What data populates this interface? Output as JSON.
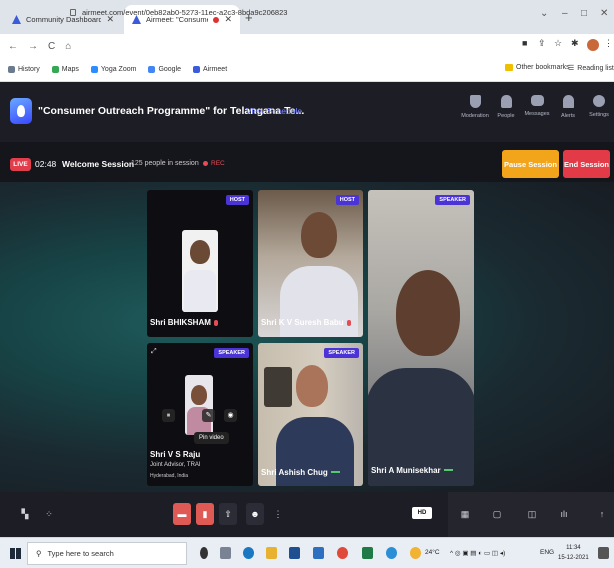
{
  "browser": {
    "tabs": [
      {
        "title": "Community Dashboard - TRAI",
        "active": false
      },
      {
        "title": "Airmeet: \"Consumer Outrea",
        "active": true
      }
    ],
    "new_tab": "+",
    "window_controls": [
      "⌄",
      "–",
      "□",
      "✕"
    ],
    "url": "airmeet.com/event/0eb82ab0-5273-11ec-a2c3-8bda9c206823",
    "bookmarks": [
      {
        "label": "History",
        "color": "#6b7a8f"
      },
      {
        "label": "Maps",
        "color": "#34a853"
      },
      {
        "label": "Yoga Zoom",
        "color": "#2d8cff"
      },
      {
        "label": "Google",
        "color": "#4285f4"
      },
      {
        "label": "Airmeet",
        "color": "#3b5bdb"
      }
    ],
    "other_bookmarks": "Other bookmarks",
    "reading_list": "Reading list"
  },
  "header": {
    "event_title": "\"Consumer Outreach Programme\" for Telangana Te...",
    "view_schedule": "View Schedule",
    "nav": [
      {
        "label": "Moderation",
        "icon": "shield-icon"
      },
      {
        "label": "People",
        "icon": "people-icon"
      },
      {
        "label": "Messages",
        "icon": "messages-icon"
      },
      {
        "label": "Alerts",
        "icon": "bell-icon"
      },
      {
        "label": "Settings",
        "icon": "gear-icon"
      }
    ]
  },
  "session": {
    "live": "LIVE",
    "time": "02:48",
    "name": "Welcome Session",
    "count": "125 people in session",
    "rec": "REC",
    "pause_label": "Pause Session",
    "end_label": "End Session"
  },
  "participants": [
    {
      "name": "Shri BHIKSHAM",
      "role": "HOST",
      "mic": "muted"
    },
    {
      "name": "Shri K V Suresh Babu",
      "role": "HOST",
      "mic": "muted"
    },
    {
      "name": "Shri A Munisekhar",
      "role": "SPEAKER",
      "mic": "speaking"
    },
    {
      "name": "Shri V S Raju",
      "role": "SPEAKER",
      "mic": "",
      "designation": "Joint Advisor, TRAI",
      "location": "Hyderabad, India",
      "tooltip": "Pin video"
    },
    {
      "name": "Shri Ashish Chug",
      "role": "SPEAKER",
      "mic": "speaking"
    }
  ],
  "controls": {
    "hd": "HD"
  },
  "taskbar": {
    "search_placeholder": "Type here to search",
    "weather": "24°C",
    "lang": "ENG",
    "time": "11:34",
    "date": "15-12-2021"
  }
}
